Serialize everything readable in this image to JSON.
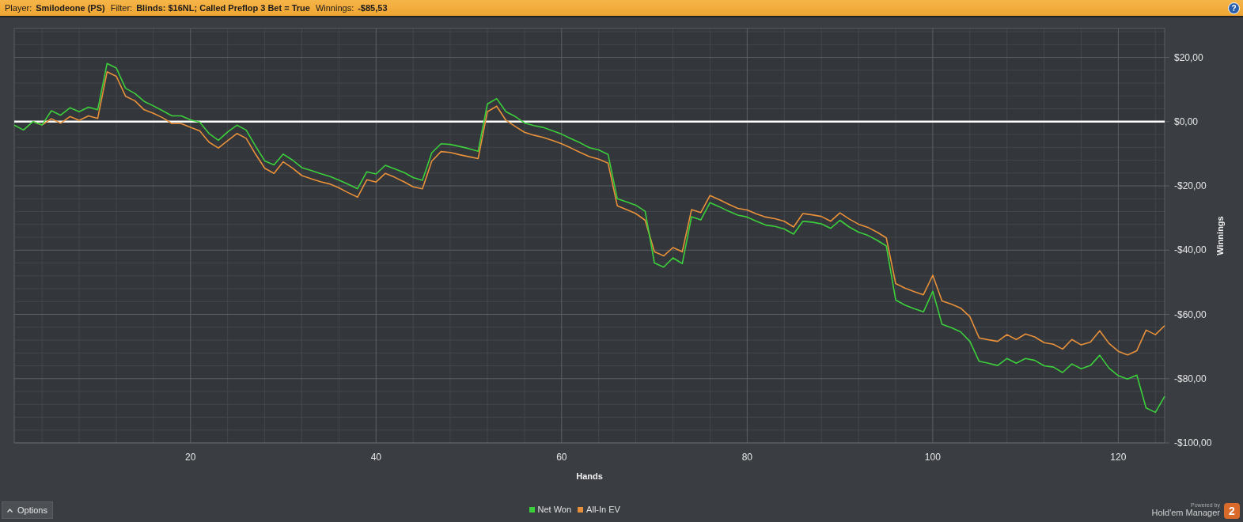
{
  "header": {
    "player_label": "Player:",
    "player": "Smilodeone (PS)",
    "filter_label": "Filter:",
    "filter": "Blinds: $16NL; Called Preflop 3 Bet = True",
    "winnings_label": "Winnings:",
    "winnings": "-$85,53",
    "help_button": "?"
  },
  "chart_data": {
    "type": "line",
    "grid": true,
    "xlabel": "Hands",
    "ylabel": "Winnings",
    "xlim": [
      1,
      125
    ],
    "ylim": [
      -100,
      29
    ],
    "xticks": [
      20,
      40,
      60,
      80,
      100,
      120
    ],
    "yticks": [
      {
        "value": 20,
        "label": "$20,00"
      },
      {
        "value": 0,
        "label": "$0,00"
      },
      {
        "value": -20,
        "label": "-$20,00"
      },
      {
        "value": -40,
        "label": "-$40,00"
      },
      {
        "value": -60,
        "label": "-$60,00"
      },
      {
        "value": -80,
        "label": "-$80,00"
      },
      {
        "value": -100,
        "label": "-$100,00"
      }
    ],
    "x": [
      1,
      2,
      3,
      4,
      5,
      6,
      7,
      8,
      9,
      10,
      11,
      12,
      13,
      14,
      15,
      16,
      17,
      18,
      19,
      20,
      21,
      22,
      23,
      24,
      25,
      26,
      27,
      28,
      29,
      30,
      31,
      32,
      33,
      34,
      35,
      36,
      37,
      38,
      39,
      40,
      41,
      42,
      43,
      44,
      45,
      46,
      47,
      48,
      49,
      50,
      51,
      52,
      53,
      54,
      55,
      56,
      57,
      58,
      59,
      60,
      61,
      62,
      63,
      64,
      65,
      66,
      67,
      68,
      69,
      70,
      71,
      72,
      73,
      74,
      75,
      76,
      77,
      78,
      79,
      80,
      81,
      82,
      83,
      84,
      85,
      86,
      87,
      88,
      89,
      90,
      91,
      92,
      93,
      94,
      95,
      96,
      97,
      98,
      99,
      100,
      101,
      102,
      103,
      104,
      105,
      106,
      107,
      108,
      109,
      110,
      111,
      112,
      113,
      114,
      115,
      116,
      117,
      118,
      119,
      120,
      121,
      122,
      123,
      124,
      125
    ],
    "series": [
      {
        "name": "Net Won",
        "color": "#3ccf3c",
        "values": [
          -1.1,
          -2.6,
          0,
          -1.0,
          3.4,
          2.0,
          4.3,
          3.1,
          4.5,
          3.7,
          18.1,
          16.7,
          10.4,
          8.8,
          6.3,
          4.9,
          3.4,
          1.8,
          1.8,
          0.6,
          -0.2,
          -3.7,
          -5.8,
          -3.2,
          -1.1,
          -2.6,
          -7.6,
          -12.2,
          -13.5,
          -10.1,
          -12.0,
          -14.3,
          -15.2,
          -16.2,
          -17.0,
          -18.2,
          -19.5,
          -20.9,
          -15.6,
          -16.3,
          -13.6,
          -14.7,
          -15.8,
          -17.4,
          -18.3,
          -9.7,
          -6.9,
          -7.1,
          -7.7,
          -8.4,
          -9.2,
          5.5,
          7.2,
          3.1,
          1.6,
          -0.4,
          -1.2,
          -1.8,
          -2.8,
          -3.9,
          -5.3,
          -6.6,
          -8.1,
          -8.8,
          -10.2,
          -24.0,
          -25.0,
          -26.0,
          -27.9,
          -44.0,
          -45.3,
          -42.4,
          -44.2,
          -29.6,
          -30.6,
          -25.2,
          -26.5,
          -27.9,
          -29.1,
          -29.7,
          -31.0,
          -32.2,
          -32.6,
          -33.4,
          -35.0,
          -31.0,
          -31.3,
          -31.8,
          -33.2,
          -30.7,
          -32.8,
          -34.4,
          -35.4,
          -36.9,
          -38.7,
          -55.5,
          -57.1,
          -58.2,
          -59.2,
          -52.8,
          -63.1,
          -64.1,
          -65.4,
          -68.4,
          -74.6,
          -75.2,
          -75.9,
          -73.7,
          -75.2,
          -73.7,
          -74.3,
          -76.0,
          -76.4,
          -78.1,
          -75.4,
          -76.9,
          -75.9,
          -72.7,
          -76.7,
          -79.1,
          -80.1,
          -78.9,
          -89.1,
          -90.5,
          -85.5
        ]
      },
      {
        "name": "All-In EV",
        "color": "#e8913a",
        "values": [
          null,
          null,
          0,
          -1.0,
          0.9,
          -0.5,
          1.6,
          0.4,
          1.8,
          1.0,
          15.5,
          14.1,
          7.9,
          6.5,
          3.7,
          2.6,
          1.2,
          -0.6,
          -0.6,
          -1.8,
          -2.9,
          -6.4,
          -8.2,
          -5.9,
          -3.7,
          -5.2,
          -10.1,
          -14.5,
          -16.1,
          -12.5,
          -14.5,
          -16.8,
          -17.8,
          -18.7,
          -19.4,
          -20.6,
          -22.1,
          -23.5,
          -18.1,
          -18.8,
          -16.1,
          -17.3,
          -18.7,
          -20.3,
          -20.9,
          -12.3,
          -9.3,
          -9.6,
          -10.3,
          -10.9,
          -11.5,
          3.1,
          4.8,
          0.4,
          -1.5,
          -3.3,
          -4.2,
          -4.9,
          -5.8,
          -6.9,
          -8.2,
          -9.6,
          -10.9,
          -11.7,
          -12.9,
          -26.2,
          -27.4,
          -28.6,
          -30.7,
          -40.5,
          -41.8,
          -39.2,
          -40.5,
          -27.4,
          -28.3,
          -23.0,
          -24.3,
          -25.7,
          -27.0,
          -27.5,
          -28.7,
          -29.7,
          -30.2,
          -31.0,
          -32.8,
          -28.6,
          -29.0,
          -29.5,
          -31.0,
          -28.4,
          -30.3,
          -31.9,
          -32.9,
          -34.4,
          -36.2,
          -50.4,
          -51.8,
          -52.9,
          -53.9,
          -47.8,
          -55.8,
          -56.8,
          -58.0,
          -60.7,
          -67.3,
          -67.9,
          -68.4,
          -66.3,
          -67.8,
          -66.1,
          -67.0,
          -68.8,
          -69.3,
          -70.8,
          -67.8,
          -69.5,
          -68.6,
          -65.1,
          -69.0,
          -71.5,
          -72.6,
          -71.3,
          -64.9,
          -66.3,
          -63.5
        ]
      }
    ]
  },
  "footer": {
    "options_button": "Options",
    "powered_by": "Powered by",
    "product": "Hold'em Manager",
    "product_badge": "2"
  }
}
